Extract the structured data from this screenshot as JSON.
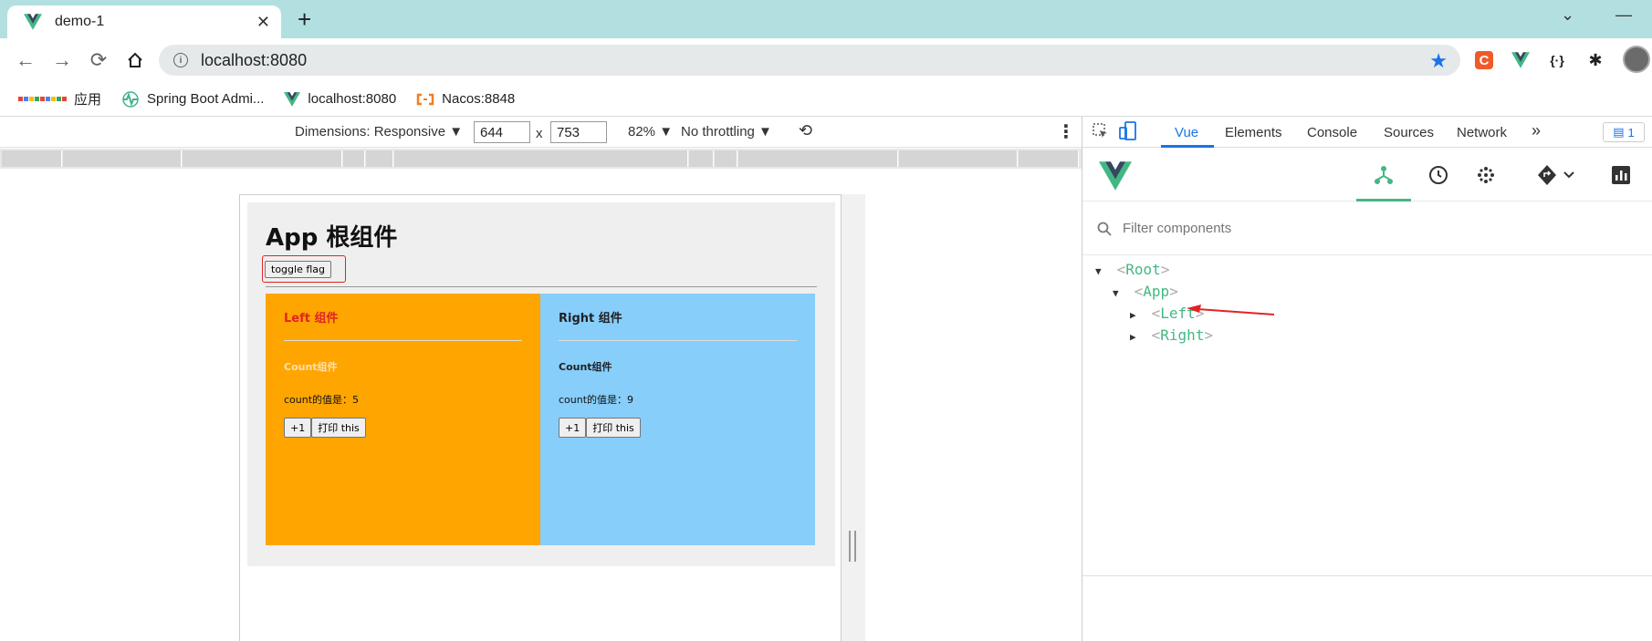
{
  "tab": {
    "title": "demo-1"
  },
  "address": {
    "url": "localhost:8080"
  },
  "bookmarks": [
    {
      "label": "应用",
      "icon": "apps-icon"
    },
    {
      "label": "Spring Boot Admi...",
      "icon": "heartbeat-icon"
    },
    {
      "label": "localhost:8080",
      "icon": "vue-icon"
    },
    {
      "label": "Nacos:8848",
      "icon": "nacos-icon"
    }
  ],
  "device_toolbar": {
    "dimensions": "Dimensions: Responsive ▼",
    "width": "644",
    "times": "x",
    "height": "753",
    "zoom": "82% ▼",
    "throttle": "No throttling ▼"
  },
  "app": {
    "title": "App 根组件",
    "toggle_label": "toggle flag",
    "left": {
      "heading": "Left 组件",
      "count_heading": "Count组件",
      "count_text": "count的值是：5",
      "plus_label": "+1",
      "print_label": "打印 this"
    },
    "right": {
      "heading": "Right 组件",
      "count_heading": "Count组件",
      "count_text": "count的值是：9",
      "plus_label": "+1",
      "print_label": "打印 this"
    }
  },
  "devtools": {
    "tabs": [
      "Vue",
      "Elements",
      "Console",
      "Sources",
      "Network"
    ],
    "more": "»",
    "issues": "1",
    "filter_placeholder": "Filter components",
    "tree": [
      {
        "name": "Root",
        "open": "▼"
      },
      {
        "name": "App",
        "open": "▼"
      },
      {
        "name": "Left",
        "open": "▶"
      },
      {
        "name": "Right",
        "open": "▶"
      }
    ]
  },
  "colors": {
    "tabstrip": "#b2e0e0",
    "left_box": "#ffa500",
    "right_box": "#87cefa",
    "vue_green": "#42b883",
    "highlight_red": "#e02424"
  }
}
